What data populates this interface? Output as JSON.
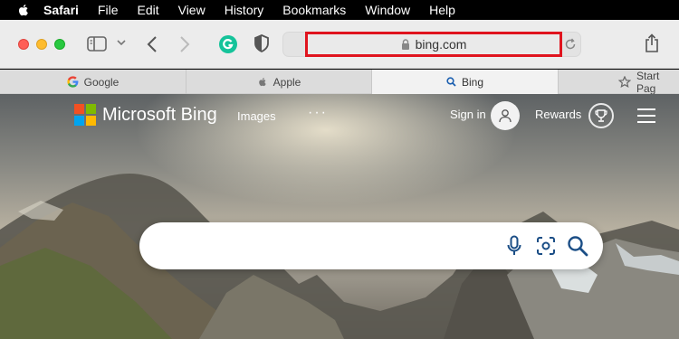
{
  "menubar": {
    "items": [
      "Safari",
      "File",
      "Edit",
      "View",
      "History",
      "Bookmarks",
      "Window",
      "Help"
    ]
  },
  "toolbar": {
    "url": "bing.com"
  },
  "tabs": [
    {
      "label": "Google",
      "icon": "google-icon"
    },
    {
      "label": "Apple",
      "icon": "apple-icon"
    },
    {
      "label": "Bing",
      "icon": "bing-search-icon"
    },
    {
      "label": "Start Pag",
      "icon": "star-icon"
    }
  ],
  "bing": {
    "logo": "Microsoft Bing",
    "images": "Images",
    "more": "···",
    "signin": "Sign in",
    "rewards": "Rewards",
    "search_placeholder": ""
  },
  "colors": {
    "highlight": "#e0141e",
    "ms_red": "#f25022",
    "ms_green": "#7fba00",
    "ms_blue": "#00a4ef",
    "ms_yellow": "#ffb900",
    "grammarly": "#15c39a",
    "bing_blue": "#1b4e86"
  }
}
